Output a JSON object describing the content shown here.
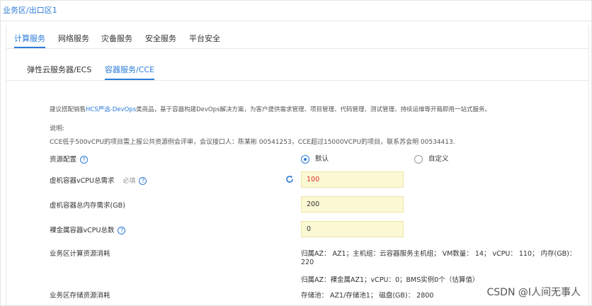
{
  "header": {
    "region": "业务区/出口区1"
  },
  "tabs": [
    {
      "label": "计算服务",
      "active": true
    },
    {
      "label": "网络服务",
      "active": false
    },
    {
      "label": "灾备服务",
      "active": false
    },
    {
      "label": "安全服务",
      "active": false
    },
    {
      "label": "平台安全",
      "active": false
    }
  ],
  "subtabs": [
    {
      "label": "弹性云服务器/ECS",
      "active": false
    },
    {
      "label": "容器服务/CCE",
      "active": true
    }
  ],
  "description": {
    "prefix": "建议搭配销售",
    "link": "HCS严选-DevOps",
    "suffix": "类商品，基于容器构建DevOps解决方案，为客户提供需求管理、项目管理、代码管理、测试管理、持续运维等开箱即用一站式服务。"
  },
  "note_title": "说明:",
  "note": "CCE低于500vCPU的项目需上报公共资源例会评审，会议接口人：陈某彬 00541253，CCE超过15000VCPU的项目，联系苏会明 00534413.",
  "resource_config": {
    "label": "资源配置",
    "options": [
      {
        "label": "默认",
        "checked": true
      },
      {
        "label": "自定义",
        "checked": false
      }
    ]
  },
  "fields": [
    {
      "label": "虚机容器vCPU总需求",
      "required": "必填",
      "value": "100",
      "help": true
    },
    {
      "label": "虚机容器总内存需求(GB)",
      "value": "200",
      "help": false
    },
    {
      "label": "裸金属容器vCPU总数",
      "value": "0",
      "help": true
    }
  ],
  "compute": {
    "label": "业务区计算资源消耗",
    "line1": "归属AZ：  AZ1；主机组：云容器服务主机组；  VM数量：  14；  vCPU：  110；  内存(GB)：",
    "line1b": "220",
    "line2": "归属AZ：裸金属AZ1；vCPU：0；BMS实例0个（估算值）"
  },
  "storage": {
    "label": "业务区存储资源消耗",
    "line1": "存储池：  AZ1/存储池1；  磁盘(GB)：  2800"
  },
  "watermark": "CSDN @I人间无事人",
  "colors": {
    "accent": "#2b7cd8",
    "field_bg": "#fbf8d4",
    "required_value": "#d93026"
  }
}
